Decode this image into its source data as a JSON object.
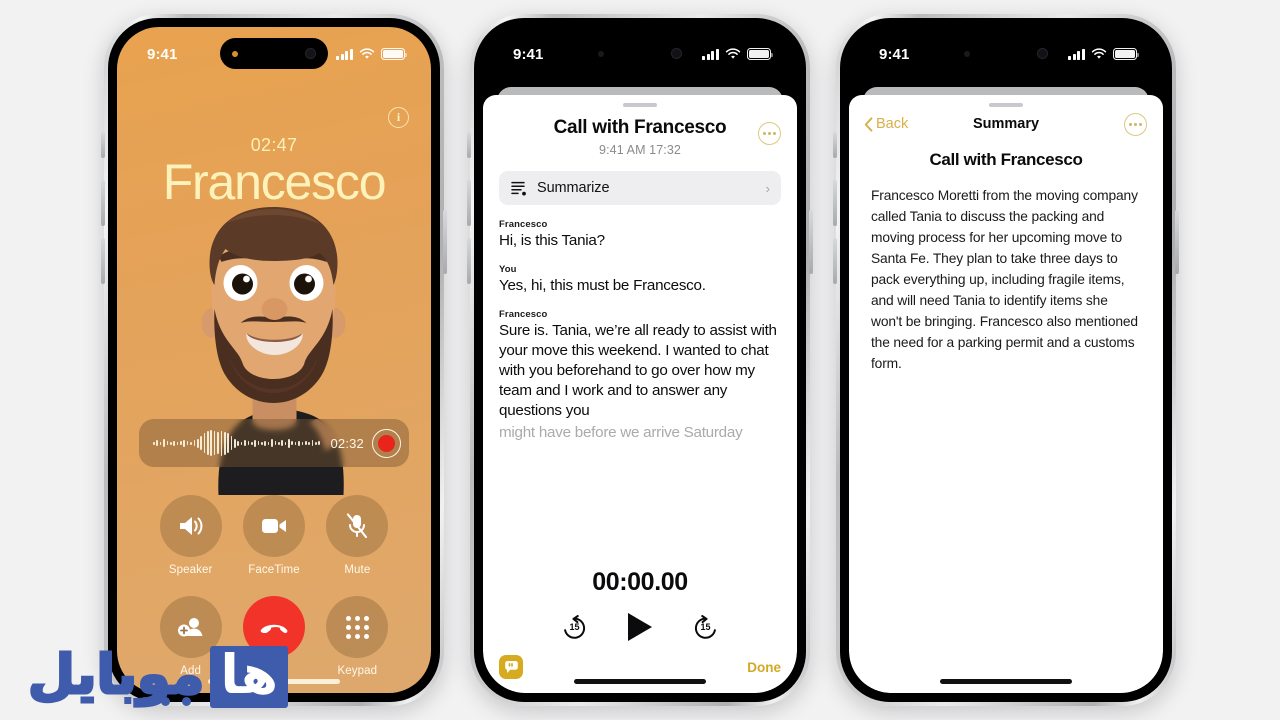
{
  "background_color": "#f2f2f3",
  "phone1": {
    "name": "in-call-screen",
    "status": {
      "time": "9:41"
    },
    "call": {
      "duration": "02:47",
      "contact_name": "Francesco",
      "info_glyph": "i"
    },
    "recorder": {
      "elapsed": "02:32",
      "record_label": "record"
    },
    "controls": [
      {
        "label": "Speaker",
        "icon": "speaker-icon"
      },
      {
        "label": "FaceTime",
        "icon": "video-camera-icon"
      },
      {
        "label": "Mute",
        "icon": "microphone-muted-icon"
      },
      {
        "label": "Add",
        "icon": "add-contact-icon"
      },
      {
        "label": "End",
        "icon": "end-call-icon"
      },
      {
        "label": "Keypad",
        "icon": "keypad-icon"
      }
    ],
    "accent_colors": {
      "background_top": "#e8a24f",
      "background_bottom": "#dda86e",
      "name_text": "#fdf2b9",
      "end_call": "#f1332a",
      "record_dot": "#e8241c"
    }
  },
  "phone2": {
    "name": "call-recording-sheet",
    "status": {
      "time": "9:41"
    },
    "header": {
      "title": "Call with Francesco",
      "subtitle": "9:41 AM  17:32",
      "more_label": "more-options"
    },
    "summarize_row": {
      "label": "Summarize",
      "icon": "summarize-icon",
      "chevron": "›"
    },
    "transcript": [
      {
        "speaker": "Francesco",
        "text": "Hi, is this Tania?",
        "faded": false
      },
      {
        "speaker": "You",
        "text": "Yes, hi, this must be Francesco.",
        "faded": false
      },
      {
        "speaker": "Francesco",
        "text": "Sure is. Tania, we’re all ready to assist with your move this weekend. I wanted to chat with you beforehand to go over how my team and I work and to answer any questions you",
        "faded": false
      },
      {
        "speaker": "",
        "text": "might have before we arrive Saturday",
        "faded": true
      }
    ],
    "player": {
      "time": "00:00.00",
      "skip_back_label": "15",
      "skip_forward_label": "15",
      "play_label": "play"
    },
    "footer": {
      "transcript_icon": "transcript-bubble-icon",
      "done_label": "Done"
    },
    "accent_colors": {
      "gold": "#d3a825",
      "transcript_icon_bg": "#d7ab1f"
    }
  },
  "phone3": {
    "name": "summary-sheet",
    "status": {
      "time": "9:41"
    },
    "nav": {
      "back_label": "Back",
      "title": "Summary",
      "more_label": "more-options"
    },
    "heading": "Call with Francesco",
    "body": "Francesco Moretti from the moving company called Tania to discuss the packing and moving process for her upcoming move to Santa Fe. They plan to take three days to pack everything up, including fragile items, and will need Tania to identify items she won't be bringing. Francesco also mentioned the need for a parking permit and a customs form.",
    "accent_colors": {
      "gold": "#d9b04a"
    }
  },
  "watermark": {
    "text_block": "ها",
    "text_outline": "موبايل",
    "color": "#3f5bab"
  }
}
